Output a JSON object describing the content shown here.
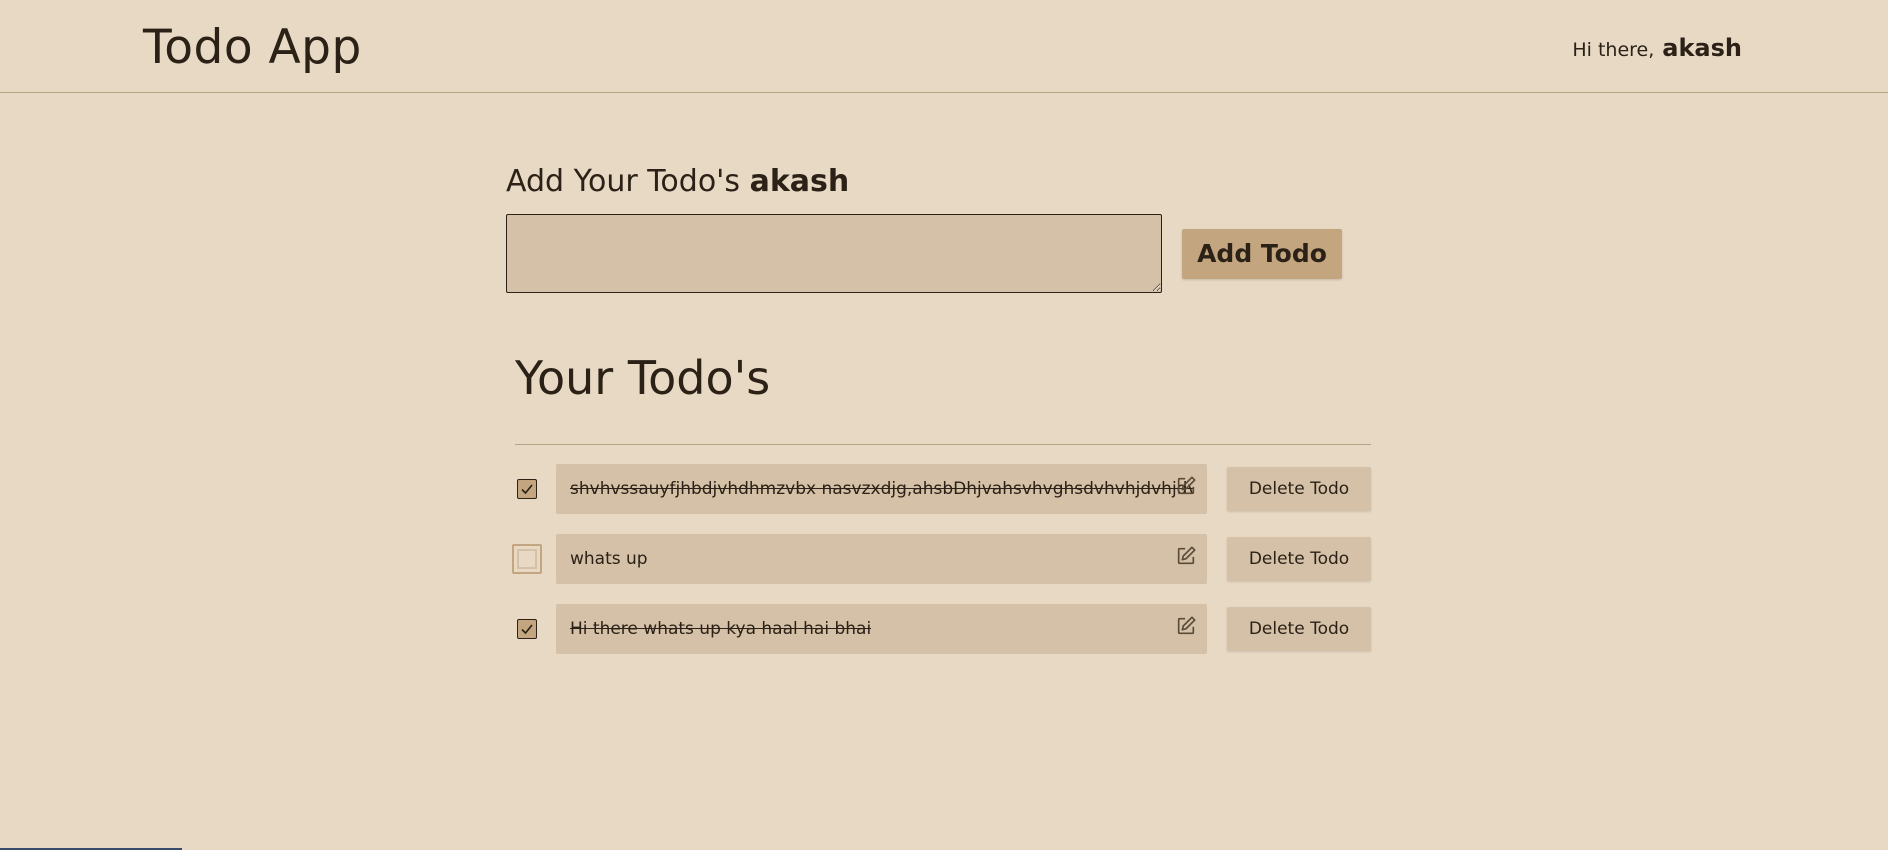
{
  "header": {
    "title": "Todo App",
    "greeting_label": "Hi there,",
    "username": "akash"
  },
  "add_section": {
    "heading_prefix": "Add Your Todo's",
    "heading_user": "akash",
    "textarea_value": "",
    "add_button_label": "Add Todo"
  },
  "list_section": {
    "heading": "Your Todo's",
    "todos": [
      {
        "text": "shvhvssauyfjhbdjvhdhmzvbx nasvzxdjg,ahsbDhjvahsvhvghsdvhvhjdvhjdvs",
        "completed": true,
        "delete_label": "Delete Todo"
      },
      {
        "text": "whats up",
        "completed": false,
        "delete_label": "Delete Todo"
      },
      {
        "text": "Hi there whats up kya haal hai bhai",
        "completed": true,
        "delete_label": "Delete Todo"
      }
    ]
  },
  "colors": {
    "background": "#e7d9c4",
    "input_bg": "#d4c1a7",
    "accent": "#c3a67f",
    "text": "#2b2116"
  },
  "icons": {
    "edit": "edit-icon",
    "check": "check-icon"
  }
}
